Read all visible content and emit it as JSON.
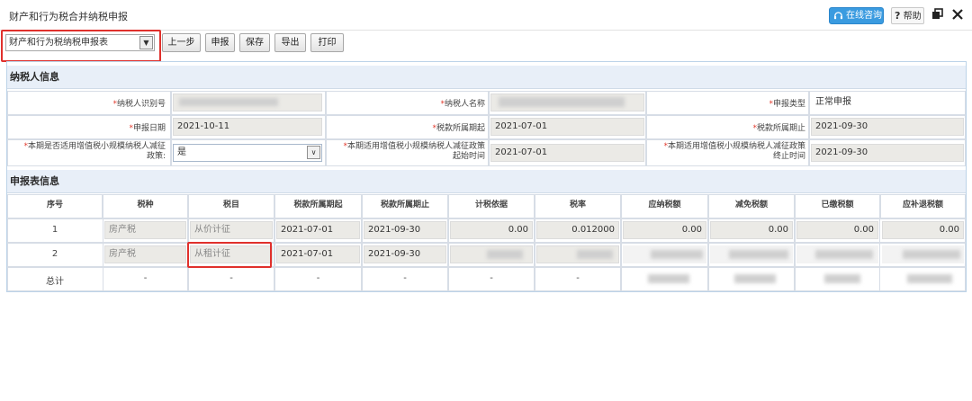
{
  "window": {
    "title": "财产和行为税合并纳税申报"
  },
  "header_actions": {
    "consult_label": "在线咨询",
    "help_label": "帮助"
  },
  "toolbar": {
    "form_select": "财产和行为税纳税申报表",
    "prev_label": "上一步",
    "declare_label": "申报",
    "save_label": "保存",
    "export_label": "导出",
    "print_label": "打印"
  },
  "taxpayer": {
    "section_title": "纳税人信息",
    "id_label": "纳税人识别号",
    "name_label": "纳税人名称",
    "type_label": "申报类型",
    "type_value": "正常申报",
    "date_label": "申报日期",
    "date_value": "2021-10-11",
    "period_start_label": "税款所属期起",
    "period_start_value": "2021-07-01",
    "period_end_label": "税款所属期止",
    "period_end_value": "2021-09-30",
    "small_scale_label_1": "本期是否适用增值税小规模纳税人减征",
    "small_scale_label_2": "政策:",
    "small_scale_value": "是",
    "policy_start_label_1": "本期适用增值税小规模纳税人减征政策",
    "policy_start_label_2": "起始时间",
    "policy_start_value": "2021-07-01",
    "policy_end_label_1": "本期适用增值税小规模纳税人减征政策",
    "policy_end_label_2": "终止时间",
    "policy_end_value": "2021-09-30"
  },
  "declaration": {
    "section_title": "申报表信息",
    "columns": [
      "序号",
      "税种",
      "税目",
      "税款所属期起",
      "税款所属期止",
      "计税依据",
      "税率",
      "应纳税额",
      "减免税额",
      "已缴税额",
      "应补退税额"
    ],
    "rows": [
      {
        "seq": "1",
        "tax_type": "房产税",
        "item": "从价计征",
        "start": "2021-07-01",
        "end": "2021-09-30",
        "basis": "0.00",
        "rate": "0.012000",
        "payable": "0.00",
        "relief": "0.00",
        "paid": "0.00",
        "refund": "0.00"
      },
      {
        "seq": "2",
        "tax_type": "房产税",
        "item": "从租计征",
        "start": "2021-07-01",
        "end": "2021-09-30"
      }
    ],
    "total_row": {
      "label": "总计",
      "dash": "-"
    }
  },
  "colors": {
    "accent": "#3a9be0",
    "highlight": "#e0302c",
    "section_bg": "#e8eff8"
  }
}
